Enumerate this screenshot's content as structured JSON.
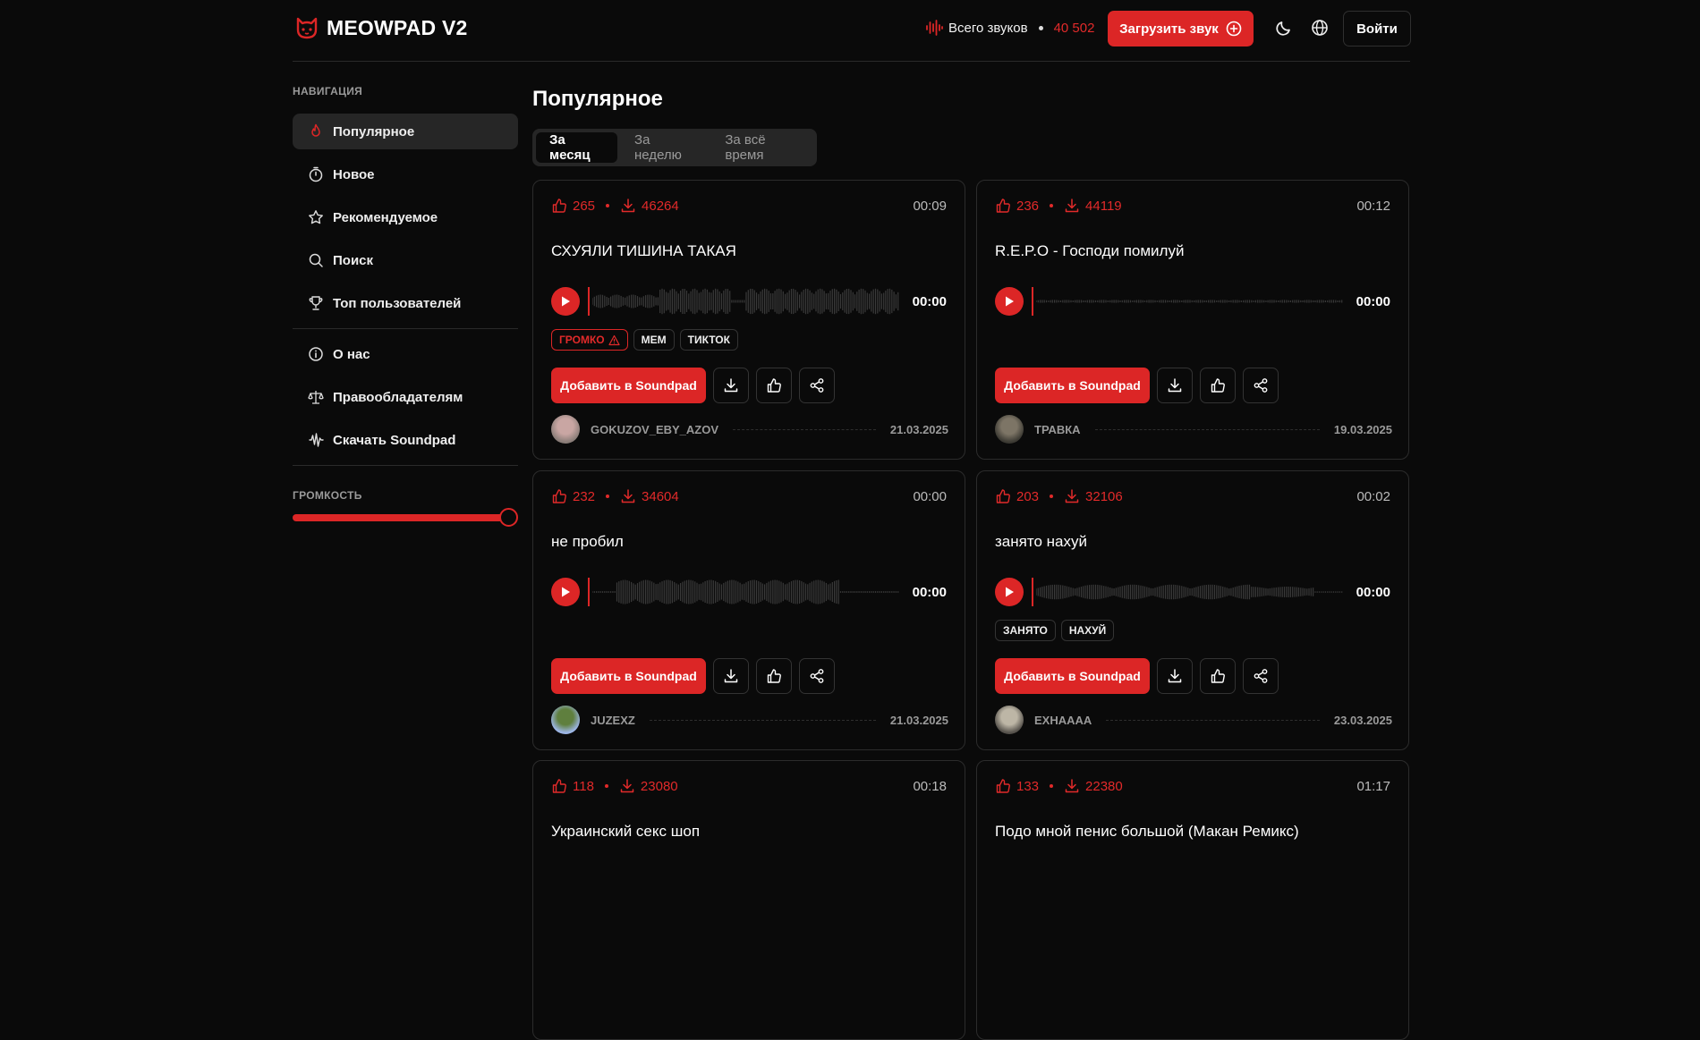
{
  "header": {
    "logo_text": "MEOWPAD V2",
    "total_label": "Всего звуков",
    "total_count": "40 502",
    "upload_label": "Загрузить звук",
    "login_label": "Войти"
  },
  "sidebar": {
    "nav_title": "НАВИГАЦИЯ",
    "items": [
      {
        "label": "Популярное",
        "icon": "flame-icon",
        "active": true
      },
      {
        "label": "Новое",
        "icon": "timer-icon"
      },
      {
        "label": "Рекомендуемое",
        "icon": "star-icon"
      },
      {
        "label": "Поиск",
        "icon": "search-icon"
      },
      {
        "label": "Топ пользователей",
        "icon": "trophy-icon"
      },
      {
        "label": "О нас",
        "icon": "info-icon"
      },
      {
        "label": "Правообладателям",
        "icon": "scales-icon"
      },
      {
        "label": "Скачать Soundpad",
        "icon": "waveform-icon"
      }
    ],
    "volume_title": "ГРОМКОСТЬ",
    "volume_level": 1.0
  },
  "main": {
    "title": "Популярное",
    "tabs": [
      "За месяц",
      "За неделю",
      "За всё время"
    ],
    "active_tab": 0,
    "add_label": "Добавить в Soundpad",
    "time_display": "00:00",
    "sounds": [
      {
        "likes": "265",
        "downloads": "46264",
        "duration": "00:09",
        "title": "СХУЯЛИ ТИШИНА ТАКАЯ",
        "tags": [
          {
            "label": "ГРОМКО",
            "warn": true
          },
          {
            "label": "МЕМ"
          },
          {
            "label": "ТИКТОК"
          }
        ],
        "author": "GOKUZOV_EBY_AZOV",
        "date": "21.03.2025"
      },
      {
        "likes": "236",
        "downloads": "44119",
        "duration": "00:12",
        "title": "R.E.P.O - Господи помилуй",
        "tags": [],
        "author": "ТРАВКА",
        "date": "19.03.2025"
      },
      {
        "likes": "232",
        "downloads": "34604",
        "duration": "00:00",
        "title": "не пробил",
        "tags": [],
        "author": "JUZEXZ",
        "date": "21.03.2025"
      },
      {
        "likes": "203",
        "downloads": "32106",
        "duration": "00:02",
        "title": "занято нахуй",
        "tags": [
          {
            "label": "ЗАНЯТО"
          },
          {
            "label": "НАХУЙ"
          }
        ],
        "author": "EXHAAAA",
        "date": "23.03.2025"
      },
      {
        "likes": "118",
        "downloads": "23080",
        "duration": "00:18",
        "title": "Украинский секс шоп"
      },
      {
        "likes": "133",
        "downloads": "22380",
        "duration": "01:17",
        "title": "Подо мной пенис большой (Макан Ремикс)"
      }
    ]
  },
  "colors": {
    "accent": "#dc2626",
    "background": "#0a0a0a",
    "muted": "#9a9a9a"
  }
}
